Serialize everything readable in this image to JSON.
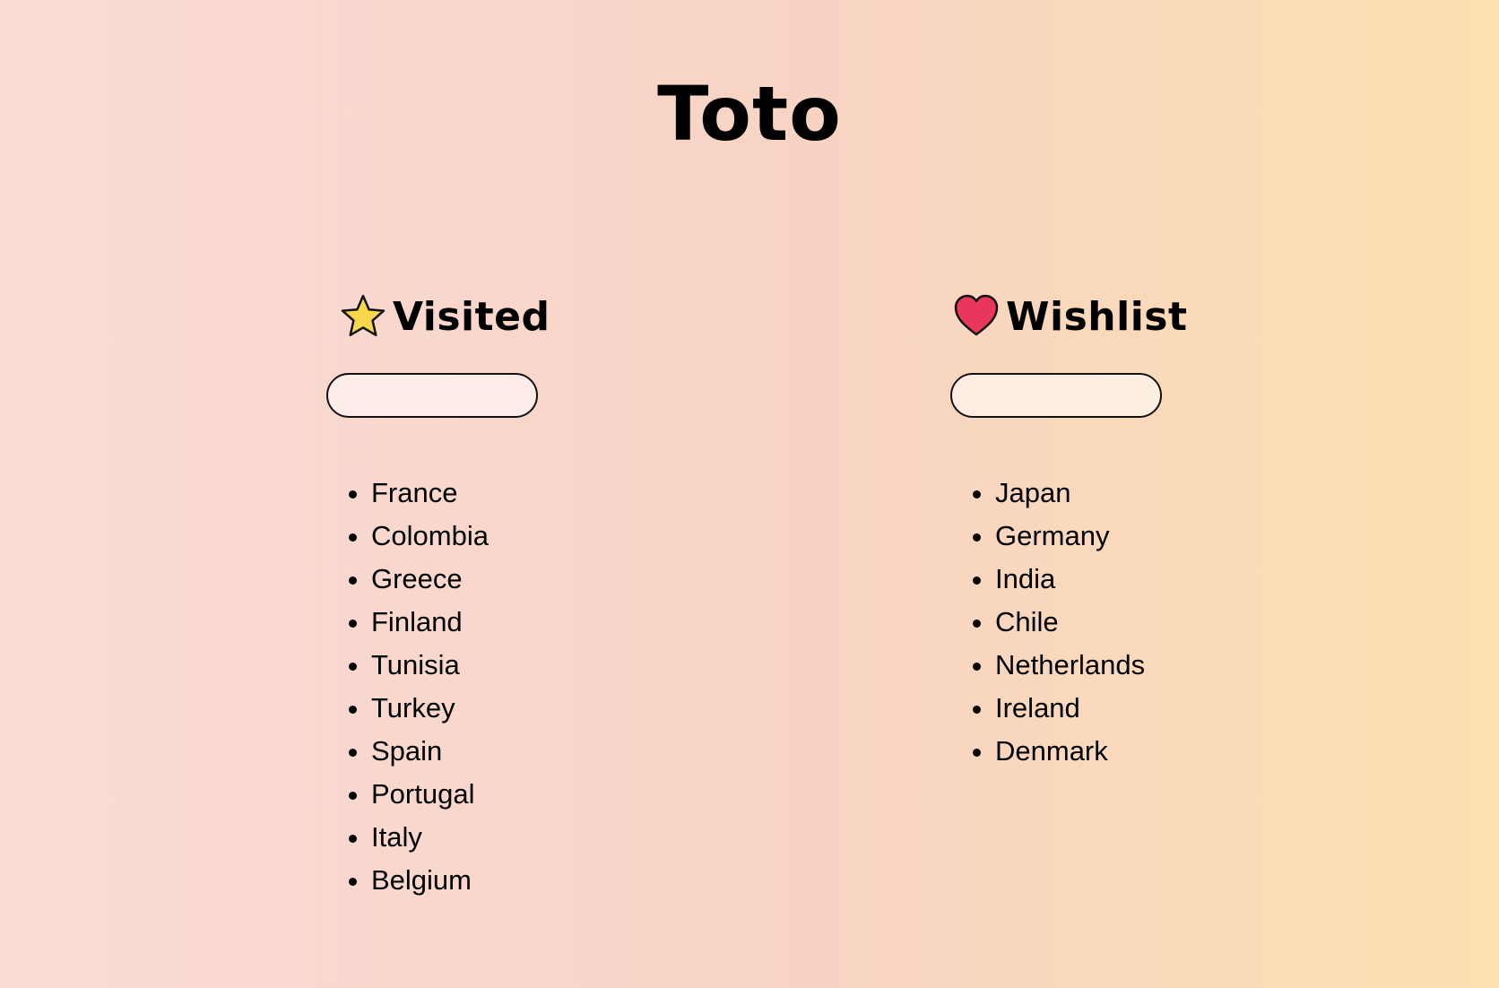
{
  "app": {
    "title": "Toto"
  },
  "colors": {
    "background_left": "#f9dbd6",
    "background_right": "#fbe0b0",
    "star": "#f6d84a",
    "heart": "#e8375a"
  },
  "visited": {
    "icon": "star-icon",
    "title": "Visited",
    "input_value": "",
    "items": [
      "France",
      "Colombia",
      "Greece",
      "Finland",
      "Tunisia",
      "Turkey",
      "Spain",
      "Portugal",
      "Italy",
      "Belgium"
    ]
  },
  "wishlist": {
    "icon": "heart-icon",
    "title": "Wishlist",
    "input_value": "",
    "items": [
      "Japan",
      "Germany",
      "India",
      "Chile",
      "Netherlands",
      "Ireland",
      "Denmark"
    ]
  }
}
